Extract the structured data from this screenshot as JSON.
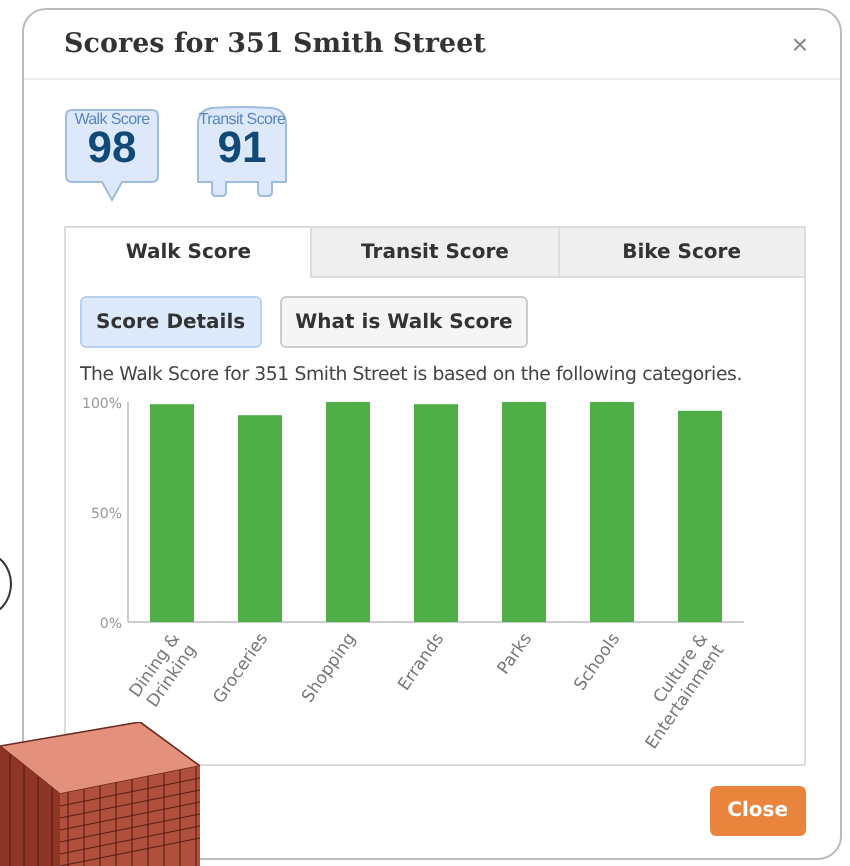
{
  "dialog": {
    "title": "Scores for 351 Smith Street",
    "close_icon": "×"
  },
  "badges": [
    {
      "kind": "walk",
      "label": "Walk Score",
      "score": "98"
    },
    {
      "kind": "transit",
      "label": "Transit Score",
      "score": "91"
    }
  ],
  "tabs": [
    {
      "label": "Walk Score",
      "selected": true
    },
    {
      "label": "Transit Score",
      "selected": false
    },
    {
      "label": "Bike Score",
      "selected": false
    }
  ],
  "subtabs": [
    {
      "label": "Score Details",
      "selected": true
    },
    {
      "label": "What is Walk Score",
      "selected": false
    }
  ],
  "description": "The Walk Score for 351 Smith Street is based on the following categories.",
  "chart_data": {
    "type": "bar",
    "categories": [
      "Dining & Drinking",
      "Groceries",
      "Shopping",
      "Errands",
      "Parks",
      "Schools",
      "Culture & Entertainment"
    ],
    "values": [
      99,
      94,
      100,
      99,
      100,
      100,
      96
    ],
    "ylim": [
      0,
      100
    ],
    "yticks": [
      {
        "value": 0,
        "label": "0%"
      },
      {
        "value": 50,
        "label": "50%"
      },
      {
        "value": 100,
        "label": "100%"
      }
    ]
  },
  "footer": {
    "close_button": "Close"
  }
}
